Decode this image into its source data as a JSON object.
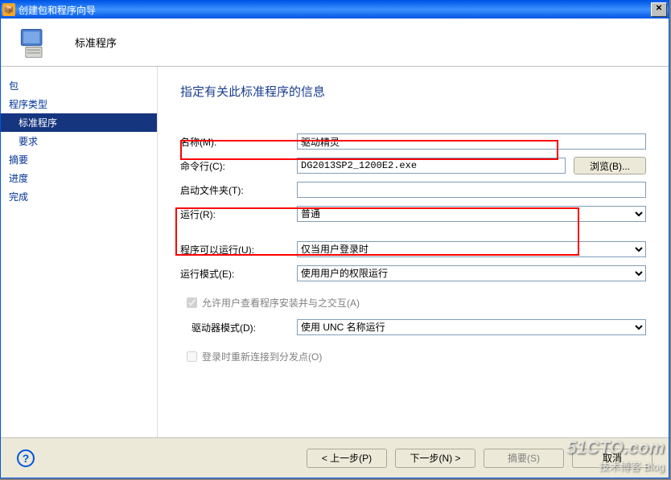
{
  "window": {
    "title": "创建包和程序向导"
  },
  "header": {
    "title": "标准程序"
  },
  "nav": {
    "items": [
      {
        "label": "包",
        "indent": false
      },
      {
        "label": "程序类型",
        "indent": false
      },
      {
        "label": "标准程序",
        "indent": true,
        "selected": true
      },
      {
        "label": "要求",
        "indent": true
      },
      {
        "label": "摘要",
        "indent": false
      },
      {
        "label": "进度",
        "indent": false
      },
      {
        "label": "完成",
        "indent": false
      }
    ]
  },
  "content": {
    "title": "指定有关此标准程序的信息",
    "fields": {
      "name_label": "名称(M):",
      "name_value": "驱动精灵",
      "command_label": "命令行(C):",
      "command_value": "DG2013SP2_1200E2.exe",
      "browse_label": "浏览(B)...",
      "startup_label": "启动文件夹(T):",
      "startup_value": "",
      "run_label": "运行(R):",
      "run_value": "普通",
      "canrun_label": "程序可以运行(U):",
      "canrun_value": "仅当用户登录时",
      "runmode_label": "运行模式(E):",
      "runmode_value": "使用用户的权限运行",
      "allow_interact_label": "允许用户查看程序安装并与之交互(A)",
      "drive_label": "驱动器模式(D):",
      "drive_value": "使用 UNC 名称运行",
      "reconnect_label": "登录时重新连接到分发点(O)"
    }
  },
  "footer": {
    "prev": "< 上一步(P)",
    "next": "下一步(N) >",
    "summary": "摘要(S)",
    "cancel": "取消"
  },
  "watermark": {
    "top": "51CTO.com",
    "bottom": "技术博客    Blog"
  }
}
